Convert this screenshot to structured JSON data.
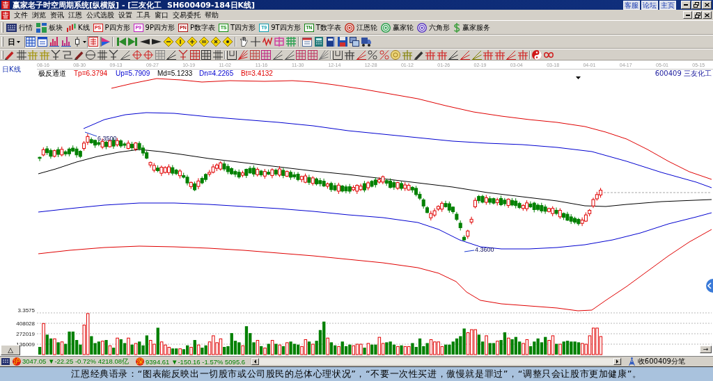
{
  "window": {
    "title": "赢家老子时空周期系统[纵横版] - [三友化工  SH600409-184日K线]",
    "links": [
      "客服",
      "论坛",
      "主页"
    ]
  },
  "menu": [
    "文件",
    "浏览",
    "资讯",
    "江恩",
    "公式选股",
    "设置",
    "工具",
    "窗口",
    "交易委托",
    "帮助"
  ],
  "toolbar": [
    {
      "kind": "keypad",
      "label": "行情"
    },
    {
      "kind": "blocks",
      "label": "板块"
    },
    {
      "kind": "candles",
      "label": "K线"
    },
    {
      "kind": "badge",
      "badge": "PS",
      "color": "#d81818",
      "label": "P四方形"
    },
    {
      "kind": "badge",
      "badge": "P9",
      "color": "#c020c0",
      "label": "9P四方形"
    },
    {
      "kind": "badge",
      "badge": "PN",
      "color": "#b01010",
      "label": "P数字表"
    },
    {
      "kind": "badge",
      "badge": "TS",
      "color": "#109010",
      "label": "T四方形"
    },
    {
      "kind": "badge",
      "badge": "T9",
      "color": "#10a0b0",
      "label": "9T四方形"
    },
    {
      "kind": "badge",
      "badge": "TN",
      "color": "#108010",
      "label": "T数字表"
    },
    {
      "kind": "ring",
      "color": "#c03020",
      "label": "江恩轮"
    },
    {
      "kind": "ring",
      "color": "#30a050",
      "label": "赢家轮"
    },
    {
      "kind": "ring",
      "color": "#6040c0",
      "label": "六角形"
    },
    {
      "kind": "dollar",
      "label": "赢家服务"
    }
  ],
  "toolbar_2": {
    "period": "日",
    "tools": [
      {
        "selected": true
      },
      {
        "selected": false
      },
      {
        "selected": false
      },
      {
        "selected": false
      },
      {
        "selected": false
      },
      {
        "selected": true
      },
      {
        "selected": false
      },
      {
        "selected": false
      },
      {
        "selected": false
      },
      {
        "selected": false
      },
      {
        "selected": false
      },
      {
        "selected": false
      },
      {
        "selected": false
      },
      {
        "selected": false
      },
      {
        "selected": false
      },
      {
        "selected": false
      },
      {
        "selected": false
      },
      {
        "selected": false
      },
      {
        "selected": false
      },
      {
        "selected": false
      },
      {
        "selected": false
      },
      {
        "selected": false
      },
      {
        "selected": false
      },
      {
        "selected": false
      },
      {
        "selected": false
      },
      {
        "selected": false
      },
      {
        "selected": false
      },
      {
        "selected": false
      }
    ]
  },
  "chart": {
    "period_label": "日K线",
    "dates": [
      "08-16",
      "08-30",
      "09-13",
      "09-27",
      "10-19",
      "11-02",
      "11-16",
      "11-30",
      "12-14",
      "12-28",
      "01-12",
      "01-26",
      "02-19",
      "03-04",
      "03-18",
      "04-01",
      "04-17",
      "05-01",
      "05-15"
    ],
    "indicator": {
      "name": "极反通道",
      "values": [
        {
          "text": "Tp=6.3794",
          "color": "#e00000"
        },
        {
          "text": "Up=5.7909",
          "color": "#0000d0"
        },
        {
          "text": "Md=5.1233",
          "color": "#000000"
        },
        {
          "text": "Dn=4.2265",
          "color": "#0000d0"
        },
        {
          "text": "Bt=3.4132",
          "color": "#e00000"
        }
      ]
    },
    "stock": "600409 三友化工",
    "peak_label": "6.3500",
    "trough_label": "4.3600"
  },
  "volume": {
    "toggle": "△",
    "arrow": "→",
    "axis_labels": [
      "3.3575",
      "408028",
      "272019",
      "136009"
    ]
  },
  "status_bar": {
    "indices": [
      {
        "market": "沪",
        "quote": "3047.05 ▼-22.25 -0.72% 4218.08亿"
      },
      {
        "market": "深",
        "quote": "9394.61 ▼-150.16 -1.57% 5095.6"
      }
    ],
    "ticker": "收600409分笔"
  },
  "quote": "江恩经典语录：“图表能反映出一切股市或公司股民的总体心理状况”，“不要一次性买进，傲慢就是罪过”，“调整只会让股市更加健康”。"
}
